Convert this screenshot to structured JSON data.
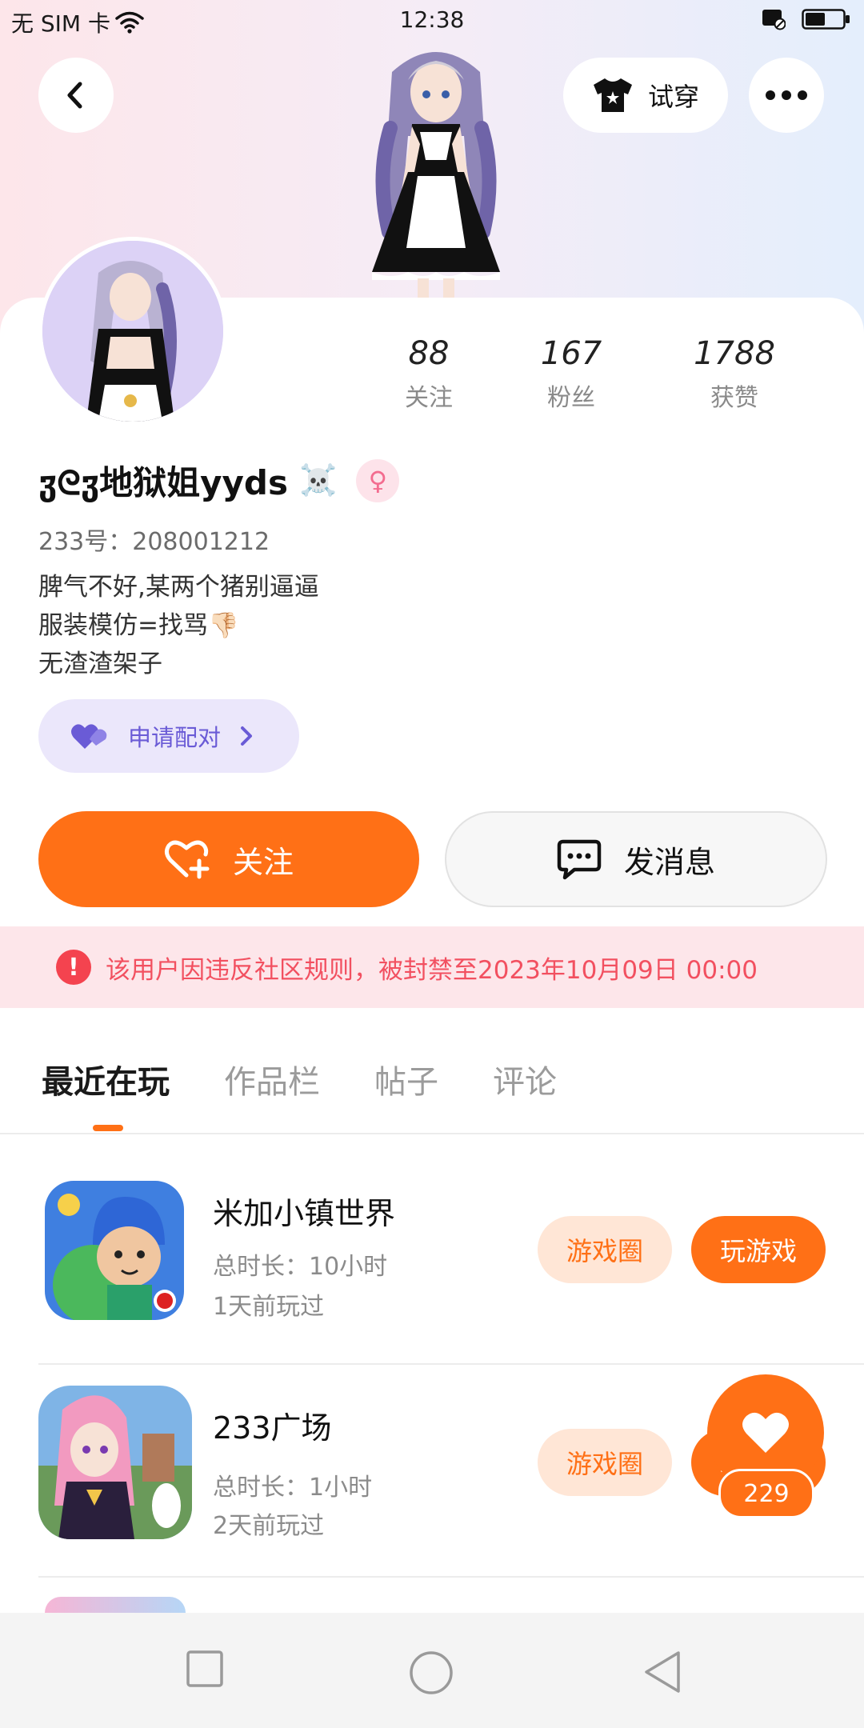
{
  "status_bar": {
    "carrier": "无 SIM 卡",
    "time": "12:38"
  },
  "header": {
    "try_on_label": "试穿"
  },
  "profile": {
    "username": "ჳᘓჳ地狱姐yyds",
    "username_emoji": "☠️",
    "gender_symbol": "♀",
    "uid": "233号：208001212",
    "bio": [
      "脾气不好,某两个猪别逼逼",
      "服装模仿=找骂👎🏻",
      "无渣渣架子"
    ],
    "stats": [
      {
        "value": "88",
        "label": "关注"
      },
      {
        "value": "167",
        "label": "粉丝"
      },
      {
        "value": "1788",
        "label": "获赞"
      }
    ],
    "pair_label": "申请配对"
  },
  "actions": {
    "follow_label": "关注",
    "message_label": "发消息"
  },
  "ban_notice": "该用户因违反社区规则，被封禁至2023年10月09日 00:00",
  "tabs": [
    {
      "label": "最近在玩",
      "active": true
    },
    {
      "label": "作品栏",
      "active": false
    },
    {
      "label": "帖子",
      "active": false
    },
    {
      "label": "评论",
      "active": false
    }
  ],
  "games": [
    {
      "title": "米加小镇世界",
      "duration": "总时长：10小时",
      "last_played": "1天前玩过",
      "circle_label": "游戏圈",
      "play_label": "玩游戏"
    },
    {
      "title": "233广场",
      "duration": "总时长：1小时",
      "last_played": "2天前玩过",
      "circle_label": "游戏圈",
      "play_label": "玩游戏"
    }
  ],
  "like_fab": {
    "count": "229"
  },
  "colors": {
    "accent": "#ff7016",
    "ban_text": "#f25060",
    "pair_text": "#6a5bd6"
  }
}
